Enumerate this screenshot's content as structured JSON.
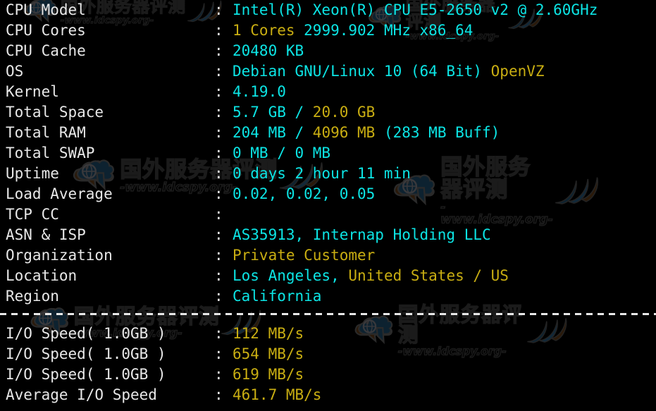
{
  "terminal": {
    "background_color": "#000000",
    "label_color": "#e8e8e8",
    "cyan_color": "#0ce5e5",
    "yellow_color": "#c9ae12",
    "separator": "----------------------------------------------------------------------"
  },
  "watermark": {
    "cn_text": "国外服务器评测",
    "url_text": "-www.idcspy.org-",
    "logo_name": "cloud-globe-logo"
  },
  "system_info": [
    {
      "label": "CPU Model",
      "colon": ":",
      "segments": [
        {
          "text": "Intel(R) Xeon(R) CPU E5-2650 v2 @ 2.60GHz",
          "color": "cyan"
        }
      ]
    },
    {
      "label": "CPU Cores",
      "colon": ":",
      "segments": [
        {
          "text": "1 Cores",
          "color": "yellow"
        },
        {
          "text": " 2999.902 MHz x86_64",
          "color": "cyan"
        }
      ]
    },
    {
      "label": "CPU Cache",
      "colon": ":",
      "segments": [
        {
          "text": "20480 KB",
          "color": "cyan"
        }
      ]
    },
    {
      "label": "OS",
      "colon": ":",
      "segments": [
        {
          "text": "Debian GNU/Linux 10 (64 Bit) ",
          "color": "cyan"
        },
        {
          "text": "OpenVZ",
          "color": "yellow"
        }
      ]
    },
    {
      "label": "Kernel",
      "colon": ":",
      "segments": [
        {
          "text": "4.19.0",
          "color": "cyan"
        }
      ]
    },
    {
      "label": "Total Space",
      "colon": ":",
      "segments": [
        {
          "text": "5.7 GB / ",
          "color": "cyan"
        },
        {
          "text": "20.0 GB",
          "color": "yellow"
        }
      ]
    },
    {
      "label": "Total RAM",
      "colon": ":",
      "segments": [
        {
          "text": "204 MB / ",
          "color": "cyan"
        },
        {
          "text": "4096 MB",
          "color": "yellow"
        },
        {
          "text": " (283 MB Buff)",
          "color": "cyan"
        }
      ]
    },
    {
      "label": "Total SWAP",
      "colon": ":",
      "segments": [
        {
          "text": "0 MB / 0 MB",
          "color": "cyan"
        }
      ]
    },
    {
      "label": "Uptime",
      "colon": ":",
      "segments": [
        {
          "text": "0 days 2 hour 11 min",
          "color": "cyan"
        }
      ]
    },
    {
      "label": "Load Average",
      "colon": ":",
      "segments": [
        {
          "text": "0.02, 0.02, 0.05",
          "color": "cyan"
        }
      ]
    },
    {
      "label": "TCP CC",
      "colon": ":",
      "segments": []
    },
    {
      "label": "ASN & ISP",
      "colon": ":",
      "segments": [
        {
          "text": "AS35913, Internap Holding LLC",
          "color": "cyan"
        }
      ]
    },
    {
      "label": "Organization",
      "colon": ":",
      "segments": [
        {
          "text": "Private Customer",
          "color": "yellow"
        }
      ]
    },
    {
      "label": "Location",
      "colon": ":",
      "segments": [
        {
          "text": "Los Angeles, ",
          "color": "cyan"
        },
        {
          "text": "United States / US",
          "color": "yellow"
        }
      ]
    },
    {
      "label": "Region",
      "colon": ":",
      "segments": [
        {
          "text": "California",
          "color": "cyan"
        }
      ]
    }
  ],
  "io_results": [
    {
      "label": "I/O Speed( 1.0GB )",
      "colon": ":",
      "segments": [
        {
          "text": "112 MB/s",
          "color": "yellow"
        }
      ]
    },
    {
      "label": "I/O Speed( 1.0GB )",
      "colon": ":",
      "segments": [
        {
          "text": "654 MB/s",
          "color": "yellow"
        }
      ]
    },
    {
      "label": "I/O Speed( 1.0GB )",
      "colon": ":",
      "segments": [
        {
          "text": "619 MB/s",
          "color": "yellow"
        }
      ]
    },
    {
      "label": "Average I/O Speed",
      "colon": ":",
      "segments": [
        {
          "text": "461.7 MB/s",
          "color": "yellow"
        }
      ]
    }
  ]
}
